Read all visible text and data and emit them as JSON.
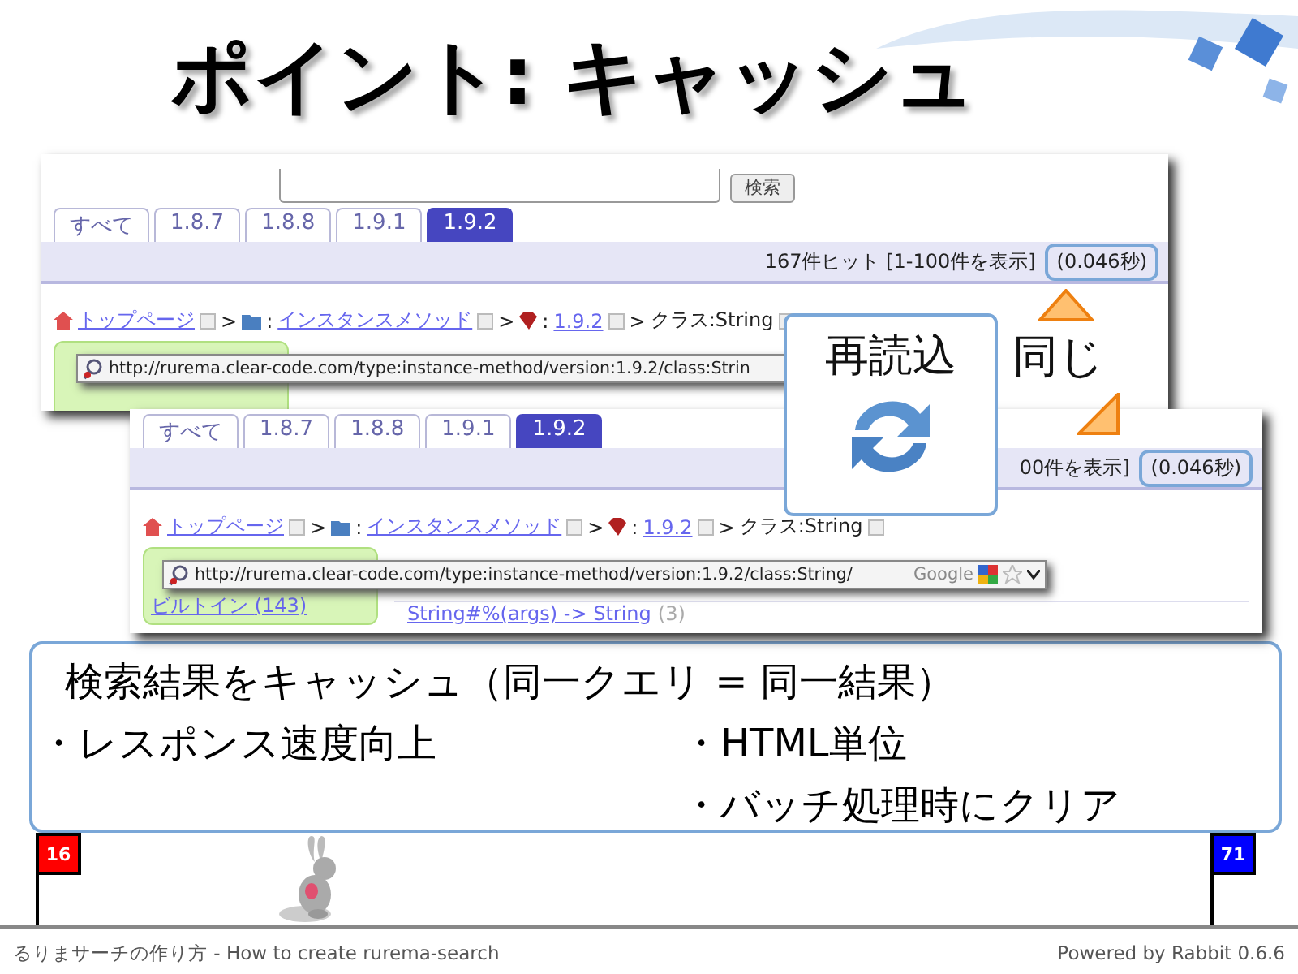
{
  "title": "ポイント: キャッシュ",
  "screenshots": [
    {
      "search_button": "検索",
      "tabs": [
        {
          "label": "すべて",
          "selected": false
        },
        {
          "label": "1.8.7",
          "selected": false
        },
        {
          "label": "1.8.8",
          "selected": false
        },
        {
          "label": "1.9.1",
          "selected": false
        },
        {
          "label": "1.9.2",
          "selected": true
        }
      ],
      "hits": "167件ヒット [1-100件を表示]",
      "time": "(0.046秒)",
      "breadcrumb": [
        {
          "kind": "home",
          "text": "トップページ"
        },
        {
          "kind": "folder",
          "sep": ">",
          "prefix": ":",
          "text": "インスタンスメソッド"
        },
        {
          "kind": "ruby",
          "sep": ">",
          "prefix": ":",
          "text": "1.9.2"
        },
        {
          "kind": "plain",
          "sep": ">",
          "text": "クラス:String"
        }
      ],
      "url": "http://rurema.clear-code.com/type:instance-method/version:1.9.2/class:Strin"
    },
    {
      "tabs": [
        {
          "label": "すべて",
          "selected": false
        },
        {
          "label": "1.8.7",
          "selected": false
        },
        {
          "label": "1.8.8",
          "selected": false
        },
        {
          "label": "1.9.1",
          "selected": false
        },
        {
          "label": "1.9.2",
          "selected": true
        }
      ],
      "hits": "00件を表示]",
      "time": "(0.046秒)",
      "breadcrumb": [
        {
          "kind": "home",
          "text": "トップページ"
        },
        {
          "kind": "folder",
          "sep": ">",
          "prefix": ":",
          "text": "インスタンスメソッド"
        },
        {
          "kind": "ruby",
          "sep": ">",
          "prefix": ":",
          "text": "1.9.2"
        },
        {
          "kind": "plain",
          "sep": ">",
          "text": "クラス:String"
        }
      ],
      "url": "http://rurema.clear-code.com/type:instance-method/version:1.9.2/class:String/",
      "search_engine": "Google",
      "sidebar_item": {
        "label": "ビルトイン",
        "count": "(143)"
      },
      "result": {
        "text": "String#%(args) -> String",
        "count": "(3)"
      }
    }
  ],
  "reload_callout": {
    "label": "再読込"
  },
  "same_label": "同じ",
  "points": {
    "heading": "検索結果をキャッシュ（同一クエリ = 同一結果）",
    "left": [
      "・レスポンス速度向上"
    ],
    "right": [
      "・HTML単位",
      "・バッチ処理時にクリア"
    ]
  },
  "progress": {
    "current": "16",
    "total": "71"
  },
  "footer": {
    "title": "るりまサーチの作り方 - How to create rurema-search",
    "powered": "Powered by Rabbit 0.6.6"
  }
}
